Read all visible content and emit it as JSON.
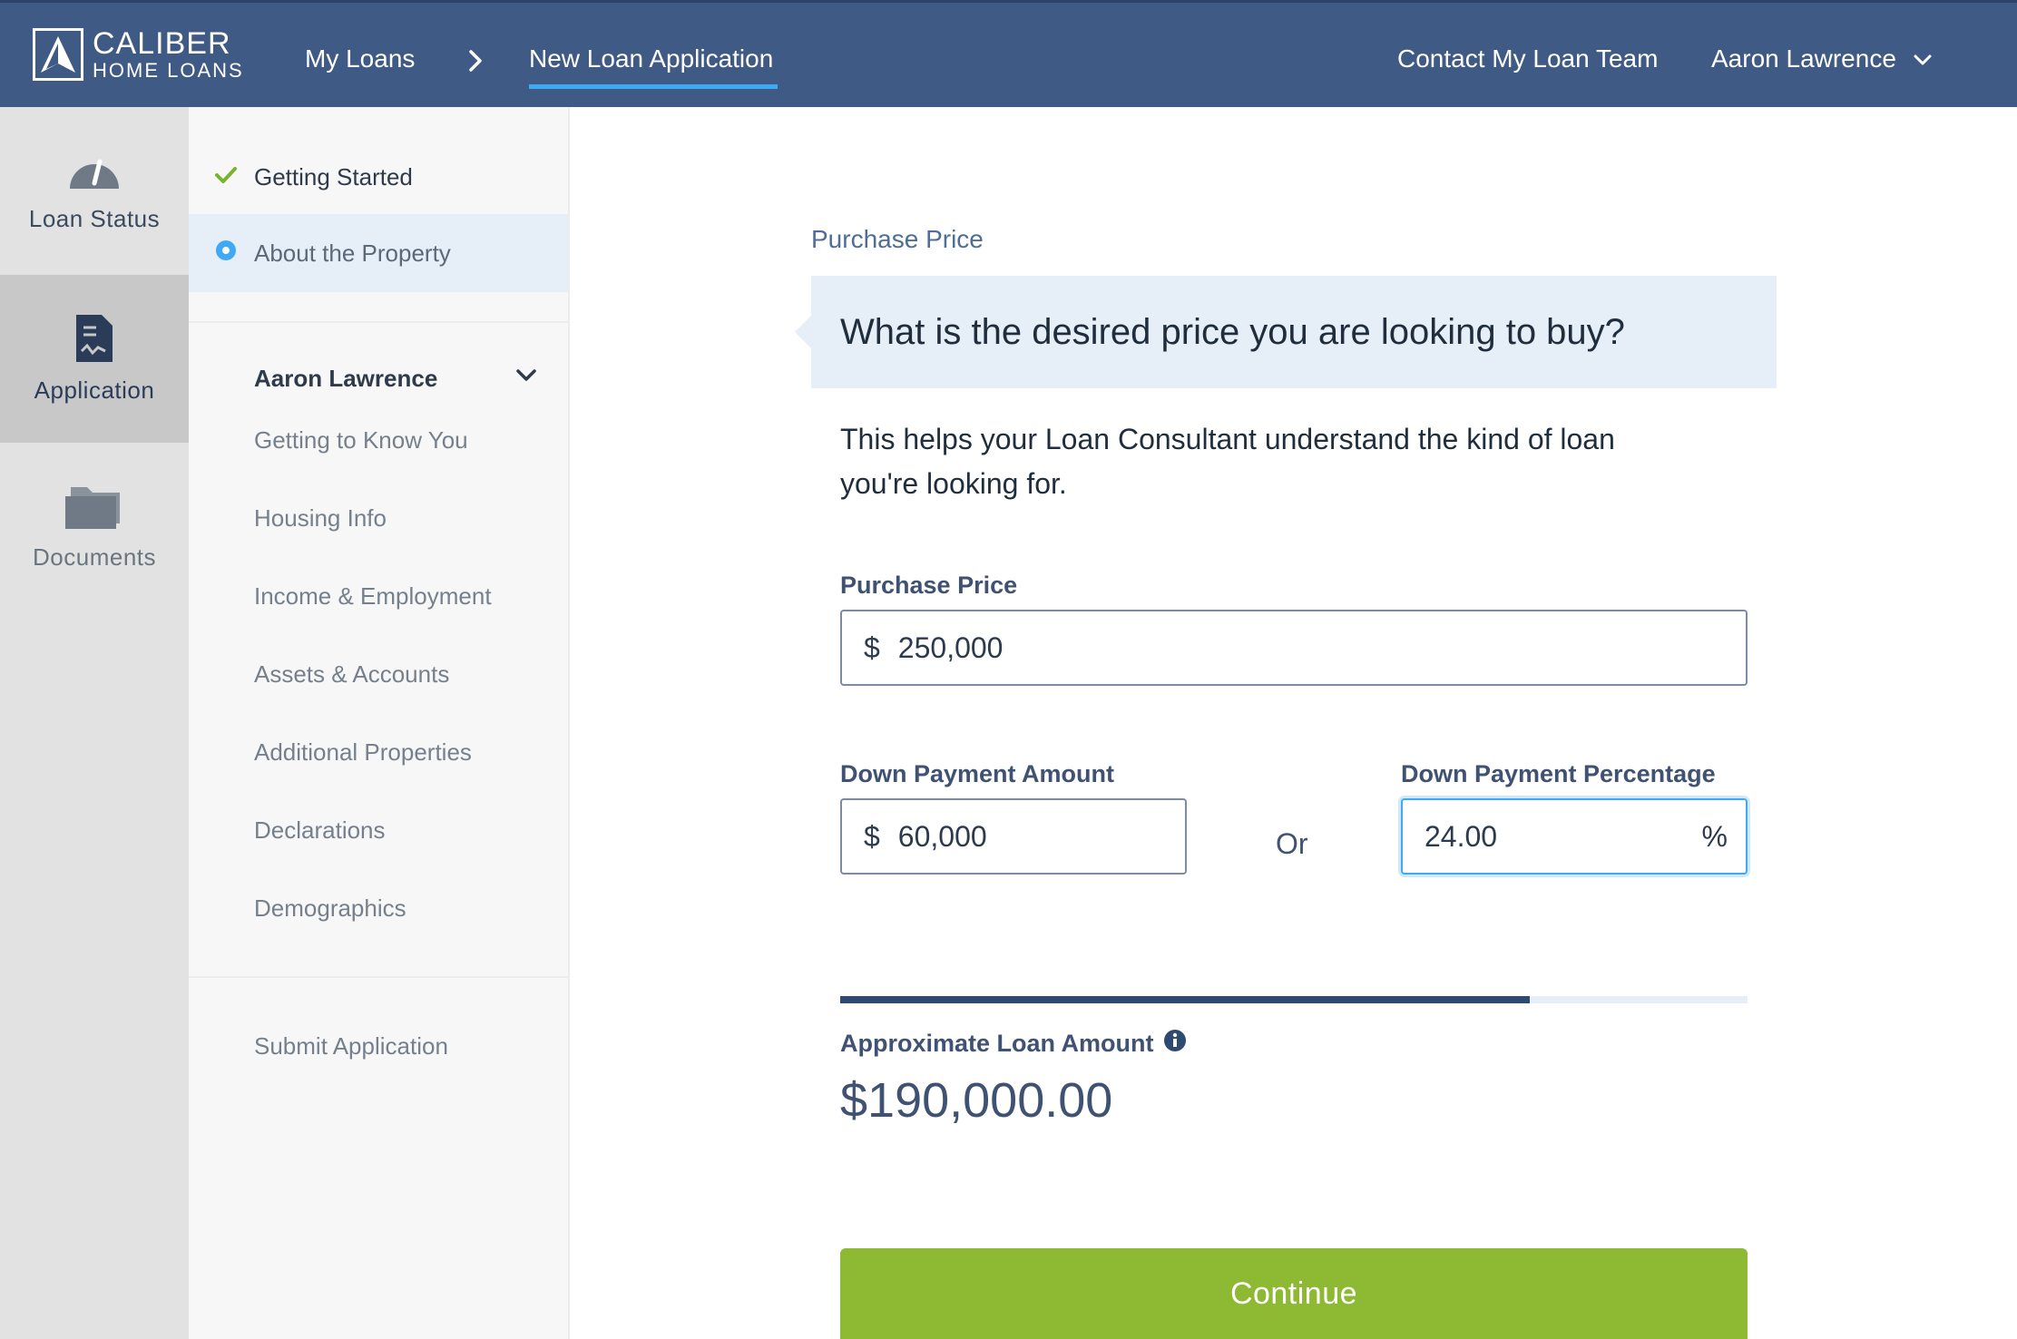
{
  "header": {
    "brand_line1": "CALIBER",
    "brand_line2": "HOME LOANS",
    "nav_my_loans": "My Loans",
    "nav_new_application": "New Loan Application",
    "nav_contact": "Contact My Loan Team",
    "user_name": "Aaron Lawrence"
  },
  "rail": {
    "items": [
      {
        "label": "Loan Status",
        "icon": "gauge-icon"
      },
      {
        "label": "Application",
        "icon": "document-icon"
      },
      {
        "label": "Documents",
        "icon": "folder-icon"
      }
    ]
  },
  "steps": {
    "top": [
      {
        "label": "Getting Started",
        "status": "done"
      },
      {
        "label": "About the Property",
        "status": "active"
      }
    ],
    "borrower_name": "Aaron Lawrence",
    "borrower_steps": [
      "Getting to Know You",
      "Housing Info",
      "Income & Employment",
      "Assets & Accounts",
      "Additional Properties",
      "Declarations",
      "Demographics"
    ],
    "submit": "Submit Application"
  },
  "main": {
    "section_title": "Purchase Price",
    "question": "What is the desired price you are looking to buy?",
    "helper_text": "This helps your Loan Consultant understand the kind of loan you're looking for.",
    "purchase_price": {
      "label": "Purchase Price",
      "prefix": "$",
      "value": "250,000"
    },
    "down_payment_amount": {
      "label": "Down Payment Amount",
      "prefix": "$",
      "value": "60,000"
    },
    "or_text": "Or",
    "down_payment_percentage": {
      "label": "Down Payment Percentage",
      "value": "24.00",
      "suffix": "%"
    },
    "loan_progress_fraction": 0.76,
    "approx_label": "Approximate Loan Amount",
    "approx_value": "$190,000.00",
    "continue_label": "Continue"
  },
  "colors": {
    "header_bg": "#3f5a85",
    "accent_blue": "#3fa9f5",
    "continue_green": "#8db933",
    "check_green": "#7ab32e"
  }
}
